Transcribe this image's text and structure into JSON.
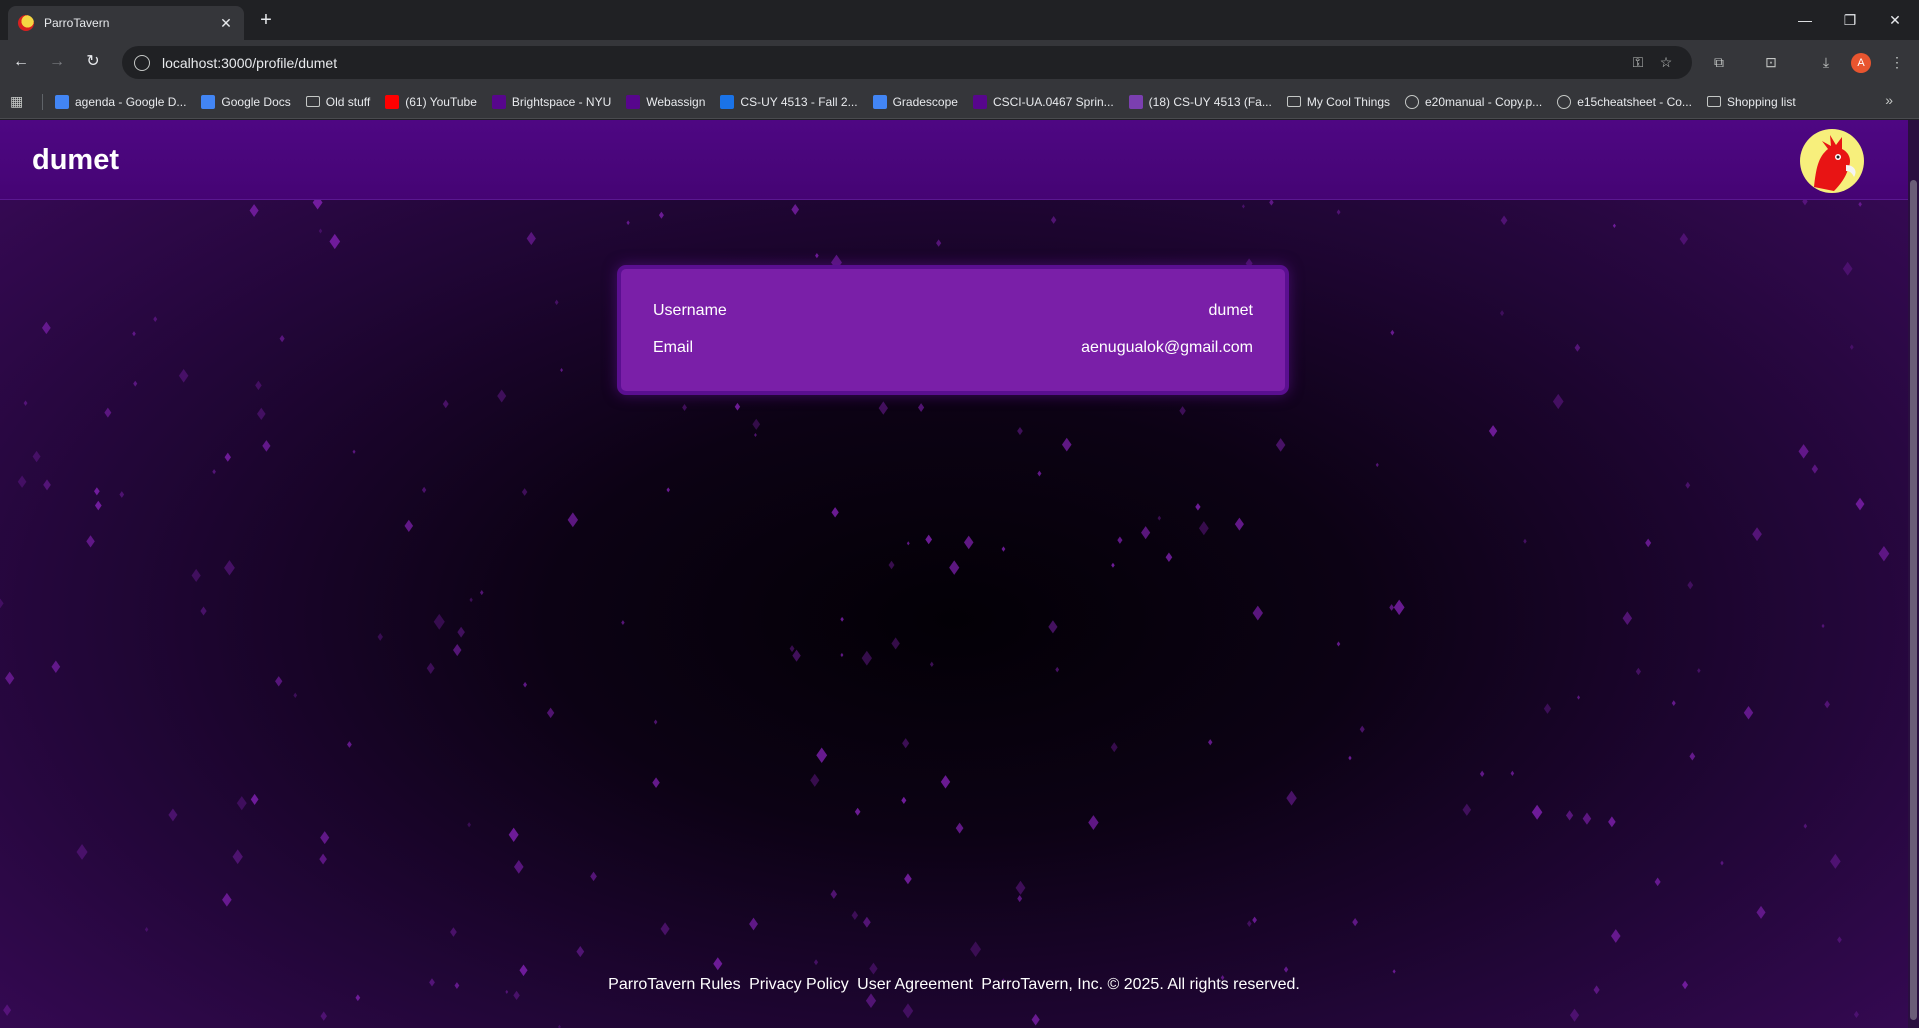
{
  "browser": {
    "tab_title": "ParroTavern",
    "url": "localhost:3000/profile/dumet",
    "profile_initial": "A",
    "bookmarks": [
      {
        "label": "agenda - Google D...",
        "color": "#4285f4"
      },
      {
        "label": "Google Docs",
        "color": "#4285f4"
      },
      {
        "label": "Old stuff",
        "color": "folder"
      },
      {
        "label": "(61) YouTube",
        "color": "#ff0000"
      },
      {
        "label": "Brightspace - NYU",
        "color": "#57068c"
      },
      {
        "label": "Webassign",
        "color": "#57068c"
      },
      {
        "label": "CS-UY 4513 - Fall 2...",
        "color": "#1a73e8"
      },
      {
        "label": "Gradescope",
        "color": "#4285f4"
      },
      {
        "label": "CSCI-UA.0467 Sprin...",
        "color": "#57068c"
      },
      {
        "label": "(18) CS-UY 4513 (Fa...",
        "color": "#7b3fb0"
      },
      {
        "label": "My Cool Things",
        "color": "folder"
      },
      {
        "label": "e20manual - Copy.p...",
        "color": "globe"
      },
      {
        "label": "e15cheatsheet - Co...",
        "color": "globe"
      },
      {
        "label": "Shopping list",
        "color": "folder"
      }
    ]
  },
  "page": {
    "header_name": "dumet",
    "profile": {
      "username_label": "Username",
      "username_value": "dumet",
      "email_label": "Email",
      "email_value": "aenugualok@gmail.com"
    },
    "footer": {
      "rules": "ParroTavern Rules",
      "privacy": "Privacy Policy",
      "agreement": "User Agreement",
      "copyright": "ParroTavern, Inc. © 2025. All rights reserved."
    }
  },
  "colors": {
    "header": "#4e0783",
    "card": "#7a1fa8",
    "sparkle": "#7a1fa8"
  }
}
